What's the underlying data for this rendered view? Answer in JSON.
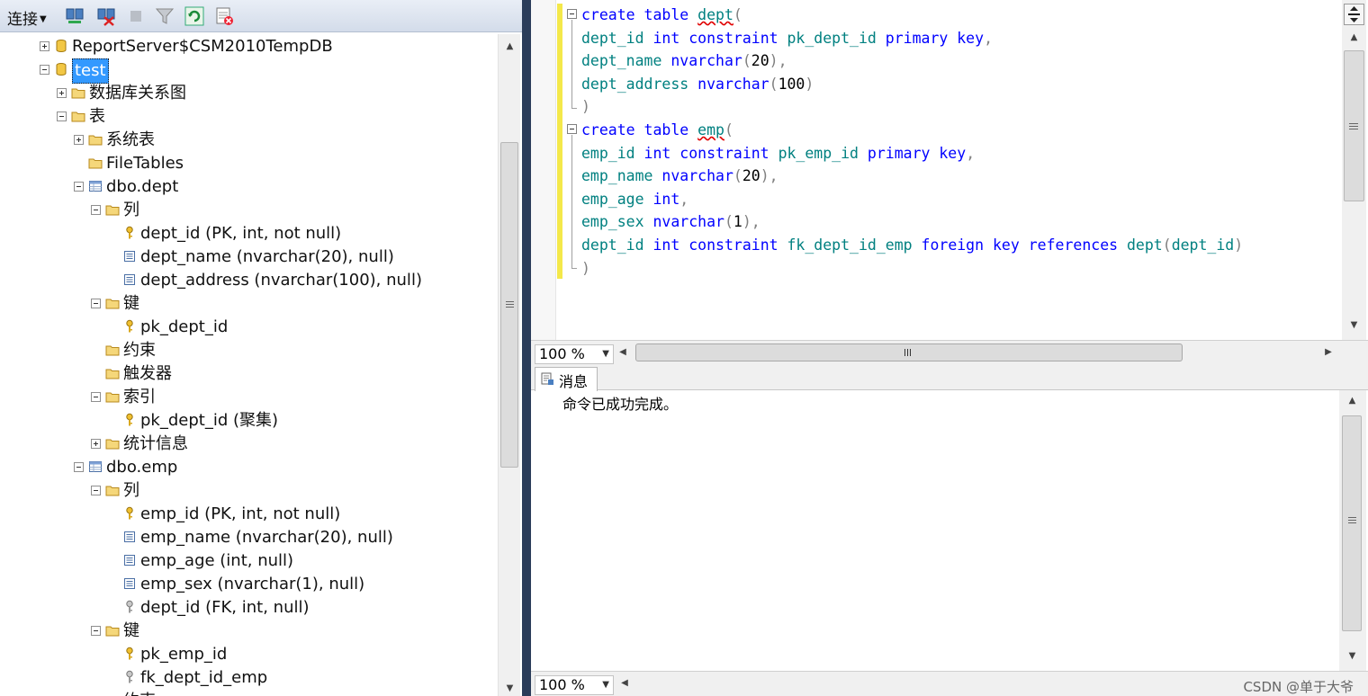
{
  "toolbar": {
    "connect_label": "连接"
  },
  "tree": {
    "items": [
      {
        "label": "ReportServer$CSM2010TempDB",
        "depth": 0,
        "expander": "plus",
        "icon": "database-icon"
      },
      {
        "label": "test",
        "depth": 0,
        "expander": "minus",
        "icon": "database-icon",
        "selected": true
      },
      {
        "label": "数据库关系图",
        "depth": 1,
        "expander": "plus",
        "icon": "folder-icon"
      },
      {
        "label": "表",
        "depth": 1,
        "expander": "minus",
        "icon": "folder-icon"
      },
      {
        "label": "系统表",
        "depth": 2,
        "expander": "plus",
        "icon": "folder-icon"
      },
      {
        "label": "FileTables",
        "depth": 2,
        "expander": "none",
        "icon": "folder-icon"
      },
      {
        "label": "dbo.dept",
        "depth": 2,
        "expander": "minus",
        "icon": "table-icon"
      },
      {
        "label": "列",
        "depth": 3,
        "expander": "minus",
        "icon": "folder-icon"
      },
      {
        "label": "dept_id (PK, int, not null)",
        "depth": 4,
        "expander": "none",
        "icon": "primary-key-icon"
      },
      {
        "label": "dept_name (nvarchar(20), null)",
        "depth": 4,
        "expander": "none",
        "icon": "column-icon"
      },
      {
        "label": "dept_address (nvarchar(100), null)",
        "depth": 4,
        "expander": "none",
        "icon": "column-icon"
      },
      {
        "label": "键",
        "depth": 3,
        "expander": "minus",
        "icon": "folder-icon"
      },
      {
        "label": "pk_dept_id",
        "depth": 4,
        "expander": "none",
        "icon": "primary-key-icon"
      },
      {
        "label": "约束",
        "depth": 3,
        "expander": "none",
        "icon": "folder-icon"
      },
      {
        "label": "触发器",
        "depth": 3,
        "expander": "none",
        "icon": "folder-icon"
      },
      {
        "label": "索引",
        "depth": 3,
        "expander": "minus",
        "icon": "folder-icon"
      },
      {
        "label": "pk_dept_id (聚集)",
        "depth": 4,
        "expander": "none",
        "icon": "primary-key-icon"
      },
      {
        "label": "统计信息",
        "depth": 3,
        "expander": "plus",
        "icon": "folder-icon"
      },
      {
        "label": "dbo.emp",
        "depth": 2,
        "expander": "minus",
        "icon": "table-icon"
      },
      {
        "label": "列",
        "depth": 3,
        "expander": "minus",
        "icon": "folder-icon"
      },
      {
        "label": "emp_id (PK, int, not null)",
        "depth": 4,
        "expander": "none",
        "icon": "primary-key-icon"
      },
      {
        "label": "emp_name (nvarchar(20), null)",
        "depth": 4,
        "expander": "none",
        "icon": "column-icon"
      },
      {
        "label": "emp_age (int, null)",
        "depth": 4,
        "expander": "none",
        "icon": "column-icon"
      },
      {
        "label": "emp_sex (nvarchar(1), null)",
        "depth": 4,
        "expander": "none",
        "icon": "column-icon"
      },
      {
        "label": "dept_id (FK, int, null)",
        "depth": 4,
        "expander": "none",
        "icon": "foreign-key-icon"
      },
      {
        "label": "键",
        "depth": 3,
        "expander": "minus",
        "icon": "folder-icon"
      },
      {
        "label": "pk_emp_id",
        "depth": 4,
        "expander": "none",
        "icon": "primary-key-icon"
      },
      {
        "label": "fk_dept_id_emp",
        "depth": 4,
        "expander": "none",
        "icon": "foreign-key-icon"
      },
      {
        "label": "约束",
        "depth": 3,
        "expander": "none",
        "icon": "folder-icon"
      }
    ]
  },
  "editor": {
    "lines": [
      [
        [
          "kw",
          "create table "
        ],
        [
          "sq",
          "dept"
        ],
        [
          "pn",
          "("
        ]
      ],
      [
        [
          "id",
          "dept_id "
        ],
        [
          "kw",
          "int constraint "
        ],
        [
          "id",
          "pk_dept_id "
        ],
        [
          "kw",
          "primary key"
        ],
        [
          "pn",
          ","
        ]
      ],
      [
        [
          "id",
          "dept_name "
        ],
        [
          "kw",
          "nvarchar"
        ],
        [
          "pn",
          "("
        ],
        [
          "nm",
          "20"
        ],
        [
          "pn",
          "),"
        ]
      ],
      [
        [
          "id",
          "dept_address "
        ],
        [
          "kw",
          "nvarchar"
        ],
        [
          "pn",
          "("
        ],
        [
          "nm",
          "100"
        ],
        [
          "pn",
          ")"
        ]
      ],
      [
        [
          "pn",
          ")"
        ]
      ],
      [
        [
          "kw",
          "create table "
        ],
        [
          "sq",
          "emp"
        ],
        [
          "pn",
          "("
        ]
      ],
      [
        [
          "id",
          "emp_id "
        ],
        [
          "kw",
          "int constraint "
        ],
        [
          "id",
          "pk_emp_id "
        ],
        [
          "kw",
          "primary key"
        ],
        [
          "pn",
          ","
        ]
      ],
      [
        [
          "id",
          "emp_name "
        ],
        [
          "kw",
          "nvarchar"
        ],
        [
          "pn",
          "("
        ],
        [
          "nm",
          "20"
        ],
        [
          "pn",
          "),"
        ]
      ],
      [
        [
          "id",
          "emp_age "
        ],
        [
          "kw",
          "int"
        ],
        [
          "pn",
          ","
        ]
      ],
      [
        [
          "id",
          "emp_sex "
        ],
        [
          "kw",
          "nvarchar"
        ],
        [
          "pn",
          "("
        ],
        [
          "nm",
          "1"
        ],
        [
          "pn",
          "),"
        ]
      ],
      [
        [
          "id",
          "dept_id "
        ],
        [
          "kw",
          "int constraint "
        ],
        [
          "id",
          "fk_dept_id_emp "
        ],
        [
          "kw",
          "foreign key references "
        ],
        [
          "id",
          "dept"
        ],
        [
          "pn",
          "("
        ],
        [
          "id",
          "dept_id"
        ],
        [
          "pn",
          ")"
        ]
      ],
      [
        [
          "pn",
          ")"
        ]
      ]
    ],
    "zoom": "100 %",
    "colors": {
      "keyword": "#0000ff",
      "identifier": "#008080",
      "punctuation": "#808080",
      "change_bar": "#f4e84a"
    }
  },
  "messages": {
    "tab_label": "消息",
    "text": "命令已成功完成。",
    "zoom": "100 %"
  },
  "watermark": "CSDN @单于大爷"
}
